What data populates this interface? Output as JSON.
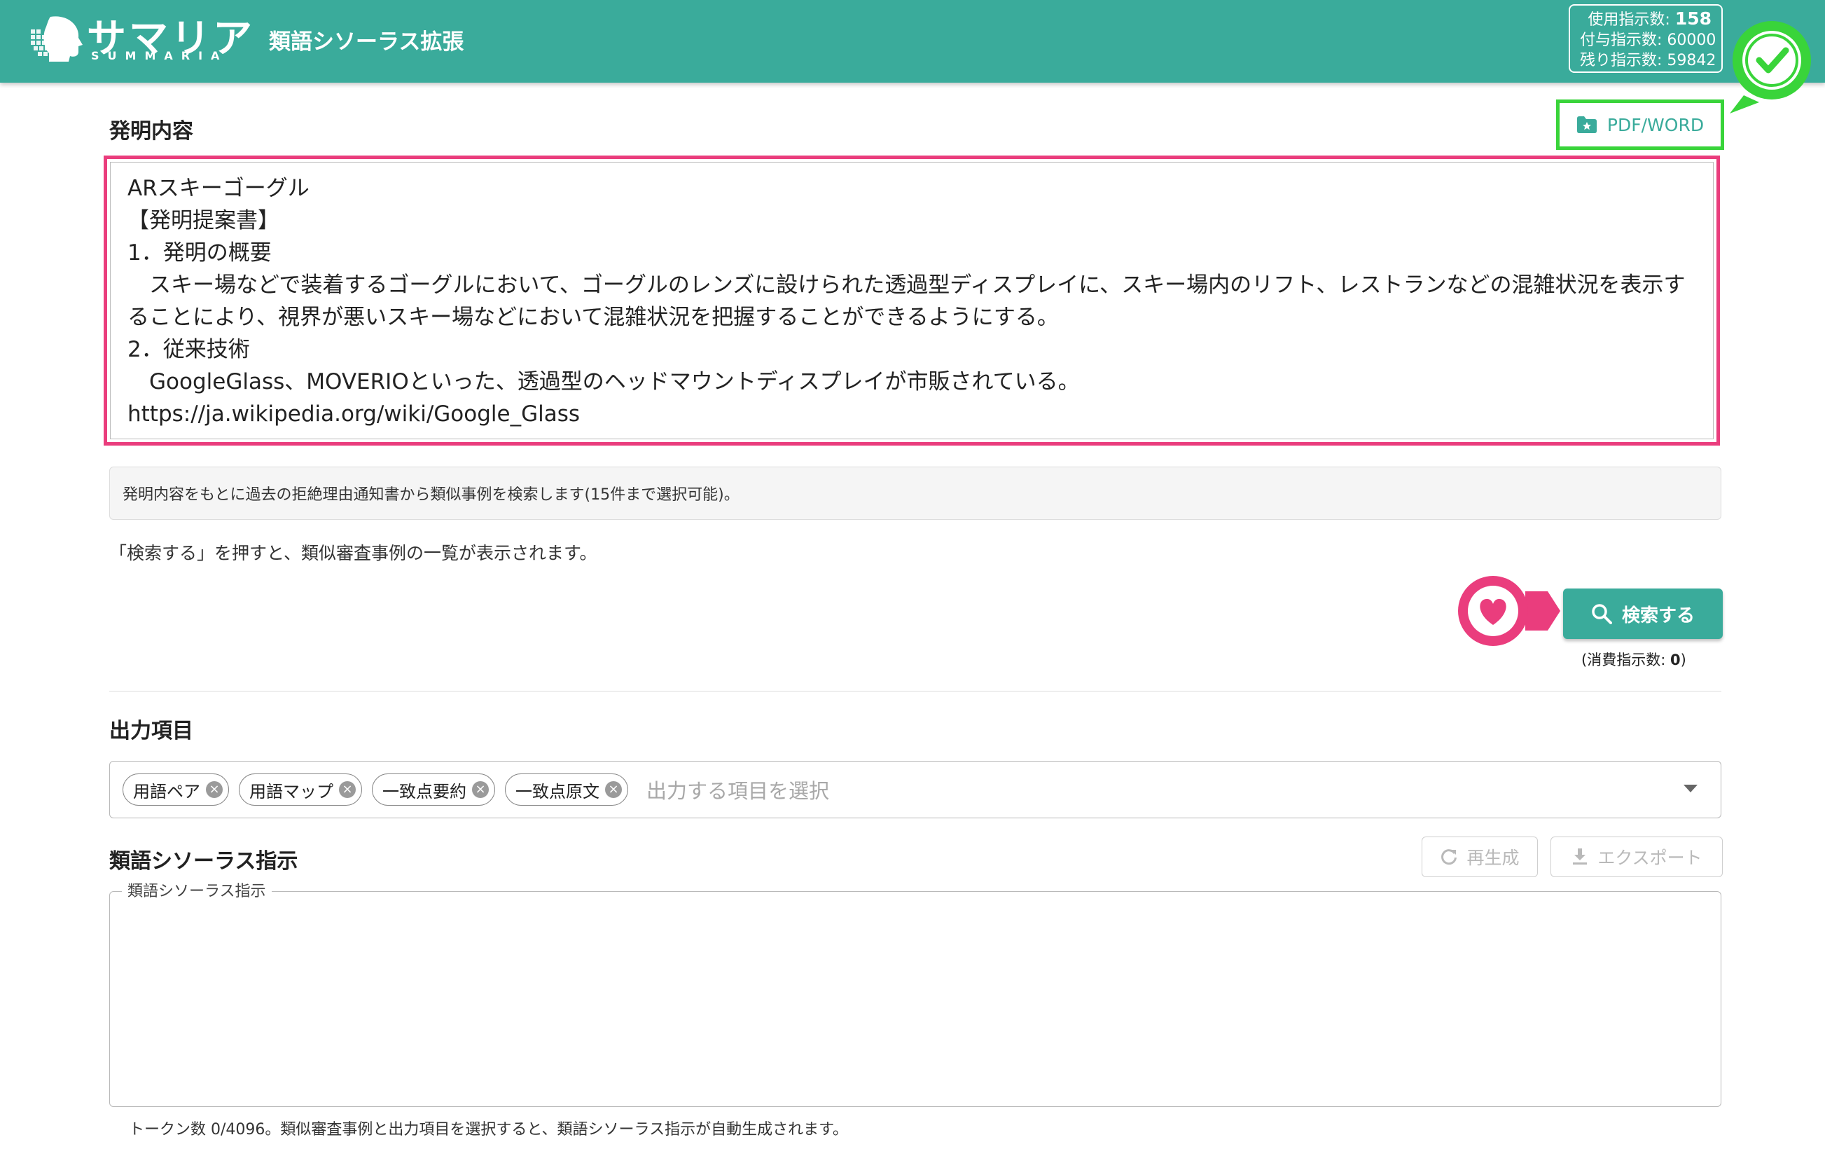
{
  "header": {
    "logo_text": "サマリア",
    "logo_sub": "SUMMARIA",
    "title": "類語シソーラス拡張",
    "counter": {
      "used_label": "使用指示数:",
      "used_value": "158",
      "granted_label": "付与指示数:",
      "granted_value": "60000",
      "remaining_label": "残り指示数:",
      "remaining_value": "59842"
    }
  },
  "invention": {
    "title": "発明内容",
    "upload_label": "PDF/WORD",
    "text": "ARスキーゴーグル\n【発明提案書】\n1．発明の概要\n　スキー場などで装着するゴーグルにおいて、ゴーグルのレンズに設けられた透過型ディスプレイに、スキー場内のリフト、レストランなどの混雑状況を表示することにより、視界が悪いスキー場などにおいて混雑状況を把握することができるようにする。\n2．従来技術\n　GoogleGlass、MOVERIOといった、透過型のヘッドマウントディスプレイが市販されている。\nhttps://ja.wikipedia.org/wiki/Google_Glass"
  },
  "search": {
    "info": "発明内容をもとに過去の拒絶理由通知書から類似事例を検索します(15件まで選択可能)。",
    "hint": "「検索する」を押すと、類似審査事例の一覧が表示されます。",
    "button_label": "検索する",
    "consume_label": "(消費指示数: ",
    "consume_value": "0",
    "consume_suffix": ")"
  },
  "output": {
    "title": "出力項目",
    "chips": [
      "用語ペア",
      "用語マップ",
      "一致点要約",
      "一致点原文"
    ],
    "placeholder": "出力する項目を選択"
  },
  "thesaurus": {
    "title": "類語シソーラス指示",
    "regenerate_label": "再生成",
    "export_label": "エクスポート",
    "field_label": "類語シソーラス指示",
    "token_note": "トークン数 0/4096。類似審査事例と出力項目を選択すると、類語シソーラス指示が自動生成されます。"
  },
  "colors": {
    "brand": "#3aab9b",
    "highlight_pink": "#ea3d7d",
    "highlight_green": "#39d43a"
  },
  "icons": [
    "logo-head-icon",
    "folder-star-icon",
    "search-icon",
    "chip-remove-icon",
    "dropdown-arrow-icon",
    "refresh-icon",
    "download-icon",
    "check-badge-icon",
    "heart-badge-icon"
  ]
}
